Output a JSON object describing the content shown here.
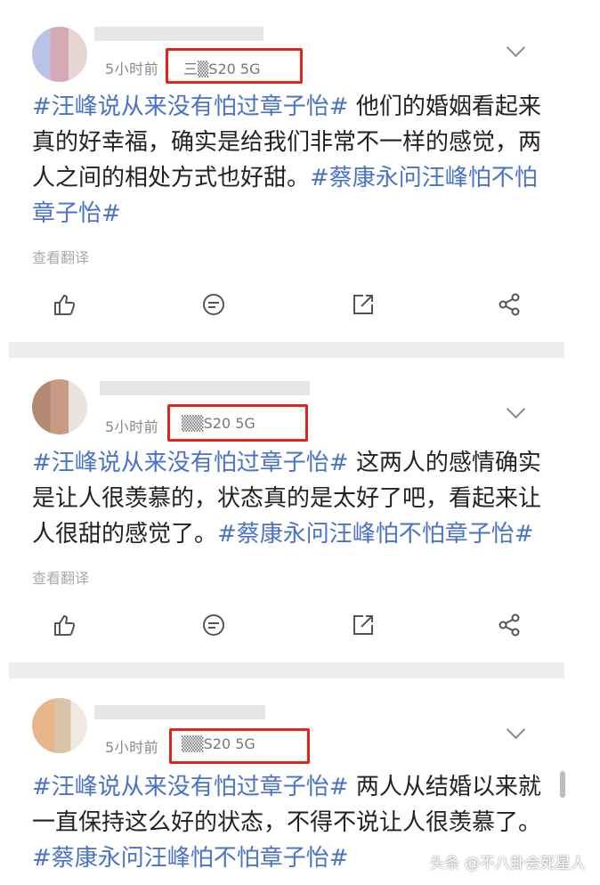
{
  "posts": [
    {
      "time": "5小时前",
      "device": "三▒S20 5G",
      "segments": [
        {
          "type": "tag",
          "text": "#汪峰说从来没有怕过章子怡#"
        },
        {
          "type": "text",
          "text": " 他们的婚姻看起来真的好幸福，确实是给我们非常不一样的感觉，两人之间的相处方式也好甜。"
        },
        {
          "type": "tag",
          "text": "#蔡康永问汪峰怕不怕章子怡#"
        }
      ],
      "translate": "查看翻译"
    },
    {
      "time": "5小时前",
      "device": "▒▒S20 5G",
      "segments": [
        {
          "type": "tag",
          "text": "#汪峰说从来没有怕过章子怡#"
        },
        {
          "type": "text",
          "text": " 这两人的感情确实是让人很羡慕的，状态真的是太好了吧，看起来让人很甜的感觉了。"
        },
        {
          "type": "tag",
          "text": "#蔡康永问汪峰怕不怕章子怡#"
        }
      ],
      "translate": "查看翻译"
    },
    {
      "time": "5小时前",
      "device": "▒▒S20 5G",
      "segments": [
        {
          "type": "tag",
          "text": "#汪峰说从来没有怕过章子怡#"
        },
        {
          "type": "text",
          "text": " 两人从结婚以来就一直保持这么好的状态，不得不说让人很羡慕了。"
        },
        {
          "type": "tag",
          "text": "#蔡康永问汪峰怕不怕章子怡#"
        }
      ]
    }
  ],
  "icons": [
    "like-icon",
    "comment-icon",
    "repost-icon",
    "share-icon",
    "chevron-down-icon"
  ],
  "colors": {
    "tag": "#4a72c8",
    "highlight_box": "#e1251b",
    "separator": "#eeeeee"
  },
  "watermark": "头条 @不八卦会死星人"
}
